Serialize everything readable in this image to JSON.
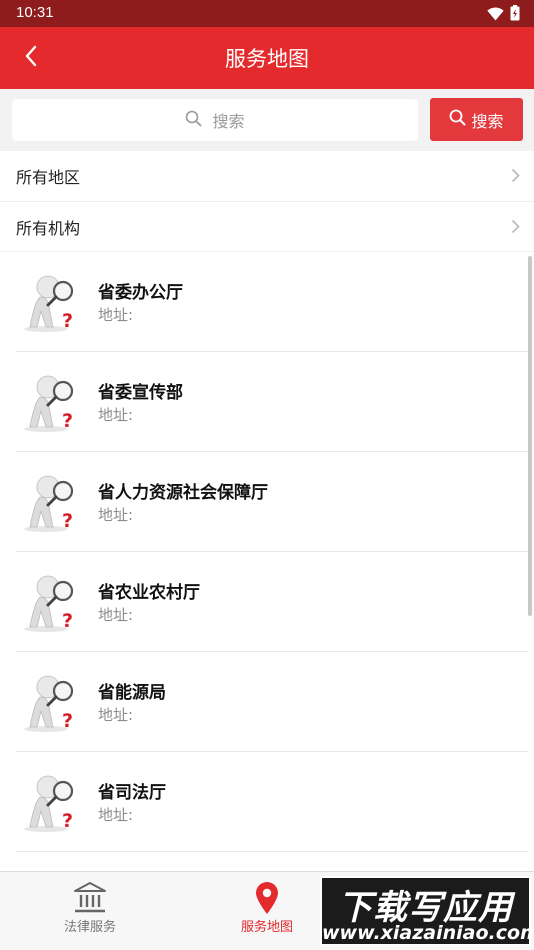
{
  "status_bar": {
    "time": "10:31"
  },
  "header": {
    "title": "服务地图"
  },
  "search": {
    "placeholder": "搜索",
    "button_label": "搜索"
  },
  "filters": [
    {
      "label": "所有地区"
    },
    {
      "label": "所有机构"
    }
  ],
  "organizations": [
    {
      "name": "省委办公厅",
      "address_label": "地址:"
    },
    {
      "name": "省委宣传部",
      "address_label": "地址:"
    },
    {
      "name": "省人力资源社会保障厅",
      "address_label": "地址:"
    },
    {
      "name": "省农业农村厅",
      "address_label": "地址:"
    },
    {
      "name": "省能源局",
      "address_label": "地址:"
    },
    {
      "name": "省司法厅",
      "address_label": "地址:"
    }
  ],
  "bottom_nav": {
    "law_service": "法律服务",
    "service_map": "服务地图"
  },
  "watermark": {
    "line1": "下载写应用",
    "line2": "www.xiazainiao.com"
  },
  "colors": {
    "brand_red": "#e42a2c",
    "status_bar": "#8e1c1c"
  }
}
